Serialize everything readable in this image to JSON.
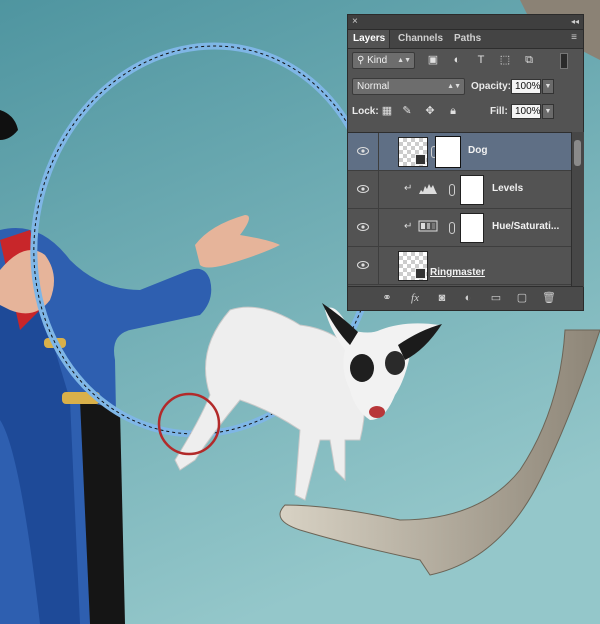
{
  "panel": {
    "close_glyph": "×",
    "collapse_glyph": "◂◂",
    "tabs": [
      {
        "label": "Layers",
        "active": true
      },
      {
        "label": "Channels",
        "active": false
      },
      {
        "label": "Paths",
        "active": false
      }
    ],
    "menu_icon": "panel-menu-icon",
    "filter": {
      "kind_label": "Kind",
      "search_glyph": "⚲"
    },
    "blend_mode": "Normal",
    "opacity_label": "Opacity:",
    "opacity_value": "100%",
    "lock_label": "Lock:",
    "fill_label": "Fill:",
    "fill_value": "100%",
    "layers": [
      {
        "name": "Dog",
        "visible": true,
        "selected": true,
        "type": "smart-object-with-mask"
      },
      {
        "name": "Levels",
        "visible": true,
        "selected": false,
        "type": "adjustment-levels",
        "clipped": true
      },
      {
        "name": "Hue/Saturati...",
        "visible": true,
        "selected": false,
        "type": "adjustment-hue-saturation",
        "clipped": true
      },
      {
        "name": "Ringmaster",
        "visible": true,
        "selected": false,
        "type": "smart-object"
      }
    ],
    "footer_icons": [
      "link-icon",
      "fx-icon",
      "add-mask-icon",
      "adjustment-icon",
      "group-folder-icon",
      "new-layer-icon",
      "trash-icon"
    ]
  },
  "colors": {
    "background_top": "#5b9ea6",
    "background_bottom": "#8cc2c6",
    "panel_bg": "#535353",
    "selected_layer": "#5f6f85",
    "circle_annotation": "#b22a2a",
    "coat_blue": "#2e5fb0"
  }
}
